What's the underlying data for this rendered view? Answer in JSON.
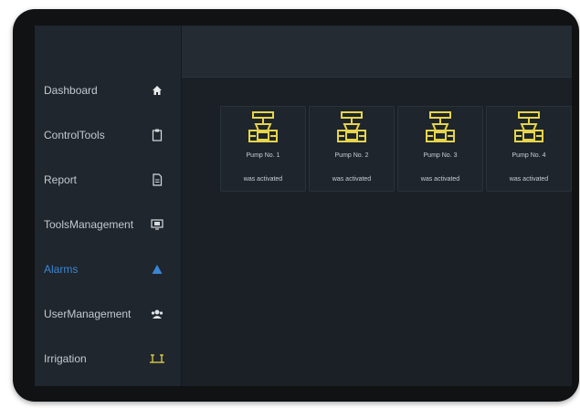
{
  "sidebar": {
    "items": [
      {
        "label": "Dashboard",
        "icon": "home-icon"
      },
      {
        "label": "ControlTools",
        "icon": "clipboard-icon"
      },
      {
        "label": "Report",
        "icon": "report-icon"
      },
      {
        "label": "ToolsManagement",
        "icon": "monitor-icon"
      },
      {
        "label": "Alarms",
        "icon": "warning-triangle-icon",
        "active": true
      },
      {
        "label": "UserManagement",
        "icon": "user-group-icon"
      },
      {
        "label": "Irrigation",
        "icon": "sprinkler-icon"
      }
    ],
    "active_color": "#3a86d6"
  },
  "alarms": {
    "cards": [
      {
        "name": "Pump No. 1",
        "status": "was activated"
      },
      {
        "name": "Pump No. 2",
        "status": "was activated"
      },
      {
        "name": "Pump No. 3",
        "status": "was activated"
      },
      {
        "name": "Pump No. 4",
        "status": "was activated"
      }
    ],
    "icon": "valve-icon",
    "icon_color": "#e6d44a"
  }
}
